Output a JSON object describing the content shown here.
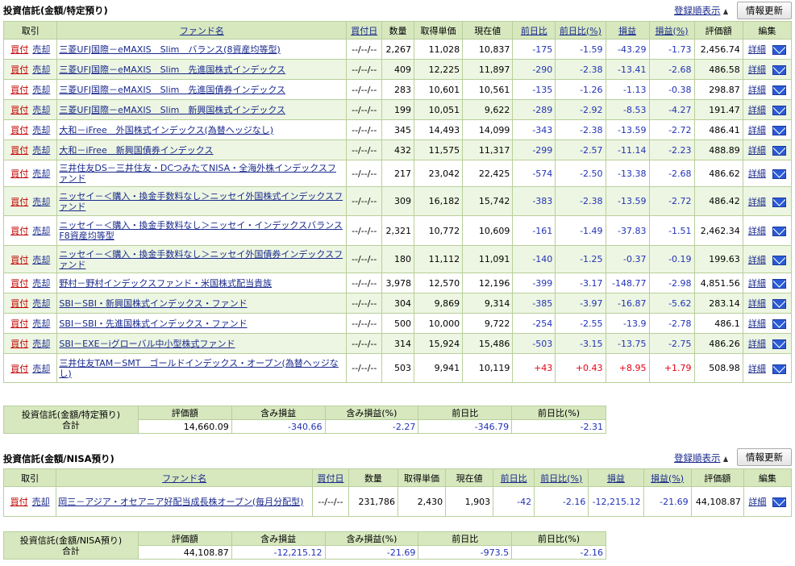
{
  "s1": {
    "title": "投資信託(金額/特定預り)",
    "sort_label": "登録順表示",
    "refresh_label": "情報更新",
    "headers": [
      "取引",
      "ファンド名",
      "買付日",
      "数量",
      "取得単価",
      "現在値",
      "前日比",
      "前日比(%)",
      "損益",
      "損益(%)",
      "評価額",
      "編集"
    ],
    "buy": "買付",
    "sell": "売却",
    "edit": "詳細",
    "rows": [
      [
        "三菱UFJ国際－eMAXIS　Slim　バランス(8資産均等型)",
        "--/--/--",
        "2,267",
        "11,028",
        "10,837",
        "-175",
        "-1.59",
        "-43.29",
        "-1.73",
        "2,456.74"
      ],
      [
        "三菱UFJ国際－eMAXIS　Slim　先進国株式インデックス",
        "--/--/--",
        "409",
        "12,225",
        "11,897",
        "-290",
        "-2.38",
        "-13.41",
        "-2.68",
        "486.58"
      ],
      [
        "三菱UFJ国際－eMAXIS　Slim　先進国債券インデックス",
        "--/--/--",
        "283",
        "10,601",
        "10,561",
        "-135",
        "-1.26",
        "-1.13",
        "-0.38",
        "298.87"
      ],
      [
        "三菱UFJ国際－eMAXIS　Slim　新興国株式インデックス",
        "--/--/--",
        "199",
        "10,051",
        "9,622",
        "-289",
        "-2.92",
        "-8.53",
        "-4.27",
        "191.47"
      ],
      [
        "大和－iFree　外国株式インデックス(為替ヘッジなし)",
        "--/--/--",
        "345",
        "14,493",
        "14,099",
        "-343",
        "-2.38",
        "-13.59",
        "-2.72",
        "486.41"
      ],
      [
        "大和－iFree　新興国債券インデックス",
        "--/--/--",
        "432",
        "11,575",
        "11,317",
        "-299",
        "-2.57",
        "-11.14",
        "-2.23",
        "488.89"
      ],
      [
        "三井住友DS－三井住友・DCつみたてNISA・全海外株インデックスファンド",
        "--/--/--",
        "217",
        "23,042",
        "22,425",
        "-574",
        "-2.50",
        "-13.38",
        "-2.68",
        "486.62"
      ],
      [
        "ニッセイ－＜購入・換金手数料なし＞ニッセイ外国株式インデックスファンド",
        "--/--/--",
        "309",
        "16,182",
        "15,742",
        "-383",
        "-2.38",
        "-13.59",
        "-2.72",
        "486.42"
      ],
      [
        "ニッセイ－＜購入・換金手数料なし＞ニッセイ・インデックスバランスF8資産均等型",
        "--/--/--",
        "2,321",
        "10,772",
        "10,609",
        "-161",
        "-1.49",
        "-37.83",
        "-1.51",
        "2,462.34"
      ],
      [
        "ニッセイ－＜購入・換金手数料なし＞ニッセイ外国債券インデックスファンド",
        "--/--/--",
        "180",
        "11,112",
        "11,091",
        "-140",
        "-1.25",
        "-0.37",
        "-0.19",
        "199.63"
      ],
      [
        "野村－野村インデックスファンド・米国株式配当貴族",
        "--/--/--",
        "3,978",
        "12,570",
        "12,196",
        "-399",
        "-3.17",
        "-148.77",
        "-2.98",
        "4,851.56"
      ],
      [
        "SBI－SBI・新興国株式インデックス・ファンド",
        "--/--/--",
        "304",
        "9,869",
        "9,314",
        "-385",
        "-3.97",
        "-16.87",
        "-5.62",
        "283.14"
      ],
      [
        "SBI－SBI・先進国株式インデックス・ファンド",
        "--/--/--",
        "500",
        "10,000",
        "9,722",
        "-254",
        "-2.55",
        "-13.9",
        "-2.78",
        "486.1"
      ],
      [
        "SBI－EXE－iグローバル中小型株式ファンド",
        "--/--/--",
        "314",
        "15,924",
        "15,486",
        "-503",
        "-3.15",
        "-13.75",
        "-2.75",
        "486.26"
      ],
      [
        "三井住友TAM－SMT　ゴールドインデックス・オープン(為替ヘッジなし)",
        "--/--/--",
        "503",
        "9,941",
        "10,119",
        "+43",
        "+0.43",
        "+8.95",
        "+1.79",
        "508.98"
      ]
    ],
    "summary": {
      "label1": "投資信託(金額/特定預り)",
      "label2": "合計",
      "headers": [
        "評価額",
        "含み損益",
        "含み損益(%)",
        "前日比",
        "前日比(%)"
      ],
      "values": [
        "14,660.09",
        "-340.66",
        "-2.27",
        "-346.79",
        "-2.31"
      ]
    }
  },
  "s2": {
    "title": "投資信託(金額/NISA預り)",
    "sort_label": "登録順表示",
    "refresh_label": "情報更新",
    "headers": [
      "取引",
      "ファンド名",
      "買付日",
      "数量",
      "取得単価",
      "現在値",
      "前日比",
      "前日比(%)",
      "損益",
      "損益(%)",
      "評価額",
      "編集"
    ],
    "buy": "買付",
    "sell": "売却",
    "edit": "詳細",
    "rows": [
      [
        "岡三－アジア・オセアニア好配当成長株オープン(毎月分配型)",
        "--/--/--",
        "231,786",
        "2,430",
        "1,903",
        "-42",
        "-2.16",
        "-12,215.12",
        "-21.69",
        "44,108.87"
      ]
    ],
    "summary": {
      "label1": "投資信託(金額/NISA預り)",
      "label2": "合計",
      "headers": [
        "評価額",
        "含み損益",
        "含み損益(%)",
        "前日比",
        "前日比(%)"
      ],
      "values": [
        "44,108.87",
        "-12,215.12",
        "-21.69",
        "-973.5",
        "-2.16"
      ]
    }
  },
  "colors": {
    "header_bg": "#d7e8bf",
    "row_alt": "#edf6e2",
    "negative": "#2232b8",
    "positive": "#e60012",
    "link": "#1a2a8c",
    "buy": "#c00000"
  }
}
